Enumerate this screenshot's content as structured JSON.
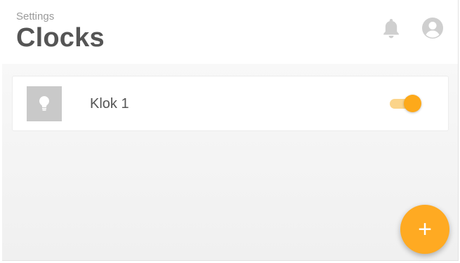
{
  "header": {
    "breadcrumb": "Settings",
    "title": "Clocks",
    "icons": [
      "bell-icon",
      "user-account-icon"
    ]
  },
  "clocks": [
    {
      "name": "Klok 1",
      "icon": "lightbulb-icon",
      "enabled": true
    }
  ],
  "fab": {
    "label": "+",
    "icon": "add-icon"
  },
  "colors": {
    "accent": "#FFAA22",
    "toggle_track": "#FBD48A",
    "icon_gray": "#CFCFCF",
    "title_text": "#555555"
  }
}
